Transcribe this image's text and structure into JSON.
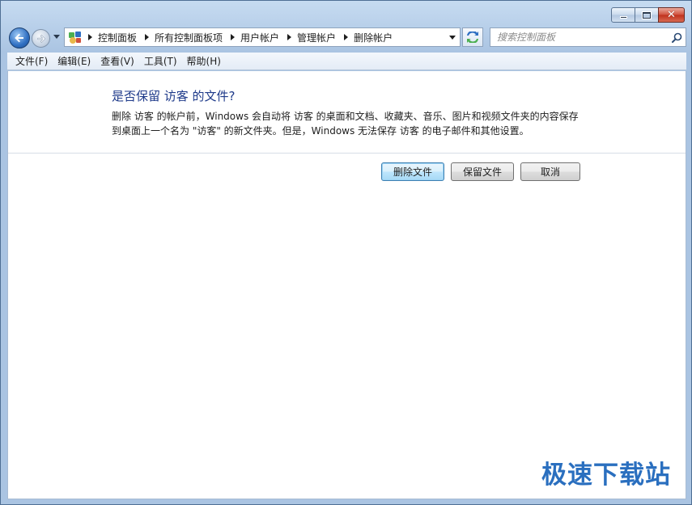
{
  "window": {
    "caption_buttons": {
      "close_glyph": "✕"
    }
  },
  "navigation": {
    "breadcrumbs": [
      "控制面板",
      "所有控制面板项",
      "用户帐户",
      "管理帐户",
      "删除帐户"
    ],
    "search_placeholder": "搜索控制面板"
  },
  "menu": {
    "items": [
      "文件(F)",
      "编辑(E)",
      "查看(V)",
      "工具(T)",
      "帮助(H)"
    ]
  },
  "dialog": {
    "heading": "是否保留 访客 的文件?",
    "description_line1": "删除 访客 的帐户前，Windows 会自动将 访客 的桌面和文档、收藏夹、音乐、图片和视频文件夹的内容保存",
    "description_line2": "到桌面上一个名为 \"访客\" 的新文件夹。但是，Windows 无法保存 访客 的电子邮件和其他设置。",
    "buttons": {
      "delete_files": "删除文件",
      "keep_files": "保留文件",
      "cancel": "取消"
    }
  },
  "watermark": "极速下载站",
  "colors": {
    "heading": "#1e3a8a",
    "window_frame": "#b9d1ea",
    "default_button_border": "#3c7fb1",
    "watermark": "#2a6fbf"
  }
}
